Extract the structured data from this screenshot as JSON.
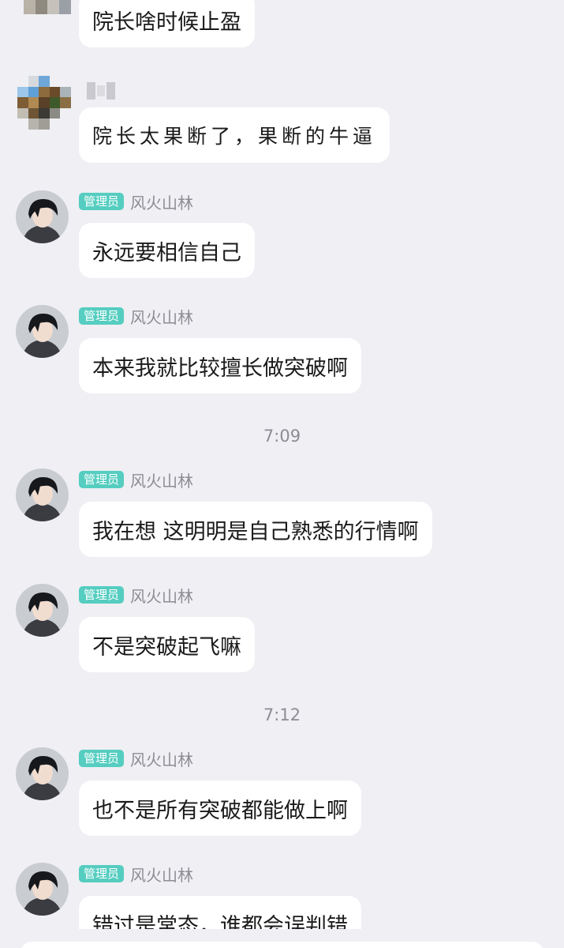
{
  "messages": [
    {
      "sender": "",
      "badge": "",
      "text": "院长啥时候止盈",
      "avatar": "blurred-avatar"
    },
    {
      "sender": "",
      "badge": "",
      "text": "院长太果断了，果断的牛逼",
      "avatar": "blurred-avatar"
    },
    {
      "sender": "风火山林",
      "badge": "管理员",
      "text": "永远要相信自己",
      "avatar": "anime-boy-avatar"
    },
    {
      "sender": "风火山林",
      "badge": "管理员",
      "text": "本来我就比较擅长做突破啊",
      "avatar": "anime-boy-avatar"
    },
    {
      "sender": "风火山林",
      "badge": "管理员",
      "text": "我在想 这明明是自己熟悉的行情啊",
      "avatar": "anime-boy-avatar"
    },
    {
      "sender": "风火山林",
      "badge": "管理员",
      "text": "不是突破起飞嘛",
      "avatar": "anime-boy-avatar"
    },
    {
      "sender": "风火山林",
      "badge": "管理员",
      "text": "也不是所有突破都能做上啊",
      "avatar": "anime-boy-avatar"
    },
    {
      "sender": "风火山林",
      "badge": "管理员",
      "text": "错过是常态，谁都会误判错",
      "avatar": "anime-boy-avatar"
    }
  ],
  "timestamps": [
    "7:09",
    "7:12"
  ],
  "colors": {
    "background": "#efeff4",
    "bubble": "#ffffff",
    "badge": "#55cdc0",
    "meta_text": "#8c8c93"
  }
}
